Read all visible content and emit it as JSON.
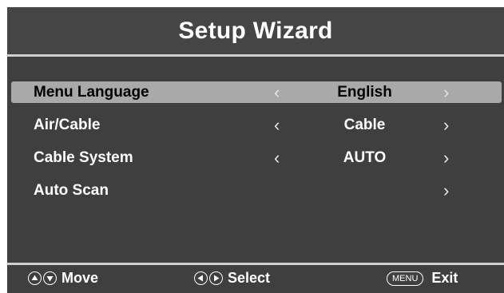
{
  "header": {
    "title": "Setup Wizard"
  },
  "menu": {
    "rows": [
      {
        "label": "Menu Language",
        "value": "English",
        "selected": true,
        "has_left": true,
        "has_right": true
      },
      {
        "label": "Air/Cable",
        "value": "Cable",
        "selected": false,
        "has_left": true,
        "has_right": true
      },
      {
        "label": "Cable System",
        "value": "AUTO",
        "selected": false,
        "has_left": true,
        "has_right": true
      },
      {
        "label": "Auto Scan",
        "value": "",
        "selected": false,
        "has_left": false,
        "has_right": true
      }
    ],
    "arrow_left": "‹",
    "arrow_right": "›"
  },
  "footer": {
    "move_label": "Move",
    "select_label": "Select",
    "menu_key": "MENU",
    "exit_label": "Exit",
    "icons": [
      "up-circle-icon",
      "down-circle-icon",
      "left-circle-icon",
      "right-circle-icon"
    ]
  },
  "colors": {
    "frame": "#3f3f3f",
    "highlight": "#a9a9a9",
    "divider": "#cfcfcf",
    "text": "#ffffff"
  }
}
